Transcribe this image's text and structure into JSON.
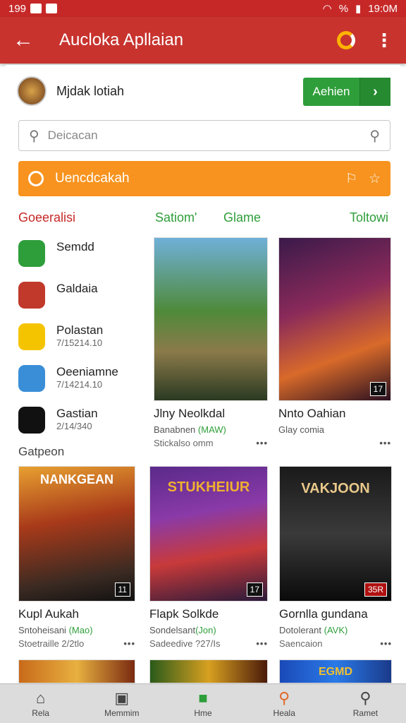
{
  "status": {
    "left": "199",
    "right": "19:0M",
    "percent": "%"
  },
  "appbar": {
    "title": "Aucloka Apllaian"
  },
  "developer": {
    "name": "Mjdak lotiah",
    "install_label": "Aehien"
  },
  "search": {
    "placeholder": "Deicacan"
  },
  "banner": {
    "text": "Uencdcakah"
  },
  "tabs": [
    "Goeeralisi",
    "Satiom'",
    "Glame",
    "Toltowi"
  ],
  "tab_colors": [
    "#c62828",
    "#2e9e3a",
    "#2e9e3a",
    "#2e9e3a"
  ],
  "apps": [
    {
      "name": "Semdd",
      "sub": "",
      "color": "#2e9e3a"
    },
    {
      "name": "Galdaia",
      "sub": "",
      "color": "#c0392b"
    },
    {
      "name": "Polastan",
      "sub": "7/15214.10",
      "color": "#f5c400"
    },
    {
      "name": "Oeeniamne",
      "sub": "7/14214.10",
      "color": "#3a8ed8"
    },
    {
      "name": "Gastian",
      "sub": "2/14/340",
      "color": "#111111"
    }
  ],
  "top_tiles": [
    {
      "title": "Jlny Neolkdal",
      "sub": "Banabnen",
      "sub_green": "(MAW)",
      "meta": "Stickalso omm"
    },
    {
      "title": "Nnto Oahian",
      "sub": "Glay comia",
      "sub_green": "",
      "meta": "",
      "badge": "17"
    }
  ],
  "section_title": "Gatpeon",
  "grid_tiles": [
    {
      "title": "Kupl Aukah",
      "sub": "Sntoheisani",
      "sub_green": "(Mao)",
      "meta": "Stoetraille 2/2tlo",
      "art_text": "NANKGEAN",
      "badge": "11"
    },
    {
      "title": "Flapk Solkde",
      "sub": "Sondelsant",
      "sub_green": "(Jon)",
      "meta": "Sadeedive ?27/Is",
      "art_text": "STUKHEIUR",
      "badge": "17"
    },
    {
      "title": "Gornlla gundana",
      "sub": "Dotolerant",
      "sub_green": "(AVK)",
      "meta": "Saencaion",
      "art_text": "VAKJOON",
      "badge": "35R"
    }
  ],
  "bottom_tiles": [
    "",
    "",
    "EGMD"
  ],
  "nav": [
    {
      "label": "Rela",
      "icon": "home-icon"
    },
    {
      "label": "Memmim",
      "icon": "camera-icon"
    },
    {
      "label": "Hme",
      "icon": "store-icon"
    },
    {
      "label": "Heala",
      "icon": "search-color-icon"
    },
    {
      "label": "Ramet",
      "icon": "search-icon"
    }
  ]
}
